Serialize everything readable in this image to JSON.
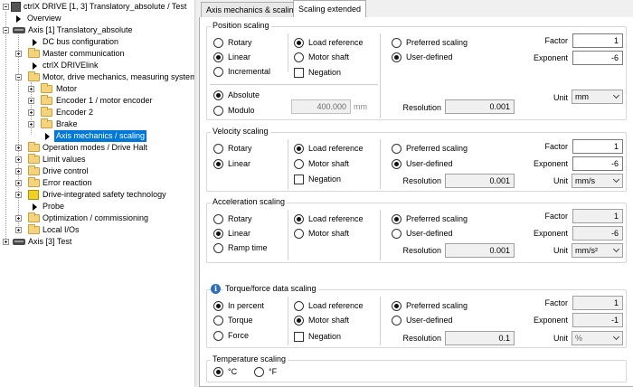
{
  "tree": {
    "items": [
      {
        "label": "ctrlX DRIVE [1, 3] Translatory_absolute / Test",
        "level": 0,
        "icon": "drive-icon",
        "expander": "minus"
      },
      {
        "label": "Overview",
        "level": 1,
        "icon": "arrow-icon"
      },
      {
        "label": "Axis [1] Translatory_absolute",
        "level": 1,
        "icon": "drive-icon",
        "expander": "minus"
      },
      {
        "label": "DC bus configuration",
        "level": 2,
        "icon": "arrow-icon"
      },
      {
        "label": "Master communication",
        "level": 2,
        "icon": "folder-icon",
        "expander": "plus"
      },
      {
        "label": "ctrlX DRIVElink",
        "level": 2,
        "icon": "arrow-icon"
      },
      {
        "label": "Motor, drive mechanics, measuring systems",
        "level": 2,
        "icon": "folder-icon",
        "expander": "minus"
      },
      {
        "label": "Motor",
        "level": 3,
        "icon": "folder-icon",
        "expander": "plus"
      },
      {
        "label": "Encoder 1 / motor encoder",
        "level": 3,
        "icon": "folder-icon",
        "expander": "plus"
      },
      {
        "label": "Encoder 2",
        "level": 3,
        "icon": "folder-icon",
        "expander": "plus"
      },
      {
        "label": "Brake",
        "level": 3,
        "icon": "folder-icon",
        "expander": "plus"
      },
      {
        "label": "Axis mechanics / scaling",
        "level": 3,
        "icon": "arrow-icon",
        "selected": true
      },
      {
        "label": "Operation modes / Drive Halt",
        "level": 2,
        "icon": "folder-icon",
        "expander": "plus"
      },
      {
        "label": "Limit values",
        "level": 2,
        "icon": "folder-icon",
        "expander": "plus"
      },
      {
        "label": "Drive control",
        "level": 2,
        "icon": "folder-icon",
        "expander": "plus"
      },
      {
        "label": "Error reaction",
        "level": 2,
        "icon": "folder-icon",
        "expander": "plus"
      },
      {
        "label": "Drive-integrated safety technology",
        "level": 2,
        "icon": "safety-icon",
        "expander": "plus"
      },
      {
        "label": "Probe",
        "level": 2,
        "icon": "arrow-icon"
      },
      {
        "label": "Optimization / commissioning",
        "level": 2,
        "icon": "folder-icon",
        "expander": "plus"
      },
      {
        "label": "Local I/Os",
        "level": 2,
        "icon": "folder-icon",
        "expander": "plus"
      },
      {
        "label": "Axis [3] Test",
        "level": 0,
        "icon": "drive-icon",
        "expander": "plus"
      }
    ]
  },
  "tabs": [
    {
      "label": "Axis mechanics & scaling",
      "active": false
    },
    {
      "label": "Scaling extended",
      "active": true
    }
  ],
  "position": {
    "title": "Position scaling",
    "type_options": [
      "Rotary",
      "Linear",
      "Incremental"
    ],
    "type_selected": "Linear",
    "ref_options": [
      "Load reference",
      "Motor shaft"
    ],
    "ref_selected": "Load reference",
    "negation_label": "Negation",
    "negation_checked": false,
    "pref_options": [
      "Preferred scaling",
      "User-defined"
    ],
    "pref_selected": "User-defined",
    "mode_options": [
      "Absolute",
      "Modulo"
    ],
    "mode_selected": "Absolute",
    "modulo_value": "400.000",
    "modulo_unit": "mm",
    "factor_label": "Factor",
    "factor": "1",
    "exponent_label": "Exponent",
    "exponent": "-6",
    "unit_label": "Unit",
    "unit": "mm",
    "resolution_label": "Resolution",
    "resolution": "0.001"
  },
  "velocity": {
    "title": "Velocity scaling",
    "type_options": [
      "Rotary",
      "Linear"
    ],
    "type_selected": "Linear",
    "ref_options": [
      "Load reference",
      "Motor shaft"
    ],
    "ref_selected": "Load reference",
    "negation_label": "Negation",
    "negation_checked": false,
    "pref_options": [
      "Preferred scaling",
      "User-defined"
    ],
    "pref_selected": "User-defined",
    "factor_label": "Factor",
    "factor": "1",
    "exponent_label": "Exponent",
    "exponent": "-6",
    "unit_label": "Unit",
    "unit": "mm/s",
    "resolution_label": "Resolution",
    "resolution": "0.001"
  },
  "acceleration": {
    "title": "Acceleration scaling",
    "type_options": [
      "Rotary",
      "Linear",
      "Ramp time"
    ],
    "type_selected": "Linear",
    "ref_options": [
      "Load reference",
      "Motor shaft"
    ],
    "ref_selected": "Load reference",
    "pref_options": [
      "Preferred scaling",
      "User-defined"
    ],
    "pref_selected": "Preferred scaling",
    "factor_label": "Factor",
    "factor": "1",
    "exponent_label": "Exponent",
    "exponent": "-6",
    "unit_label": "Unit",
    "unit": "mm/s²",
    "resolution_label": "Resolution",
    "resolution": "0.001"
  },
  "torque": {
    "title": "Torque/force data scaling",
    "type_options": [
      "In percent",
      "Torque",
      "Force"
    ],
    "type_selected": "In percent",
    "ref_options": [
      "Load reference",
      "Motor shaft"
    ],
    "ref_selected": "Motor shaft",
    "negation_label": "Negation",
    "negation_checked": false,
    "pref_options": [
      "Preferred scaling",
      "User-defined"
    ],
    "pref_selected": "Preferred scaling",
    "factor_label": "Factor",
    "factor": "1",
    "exponent_label": "Exponent",
    "exponent": "-1",
    "unit_label": "Unit",
    "unit": "%",
    "resolution_label": "Resolution",
    "resolution": "0.1"
  },
  "temperature": {
    "title": "Temperature scaling",
    "options": [
      "°C",
      "°F"
    ],
    "selected": "°C"
  }
}
